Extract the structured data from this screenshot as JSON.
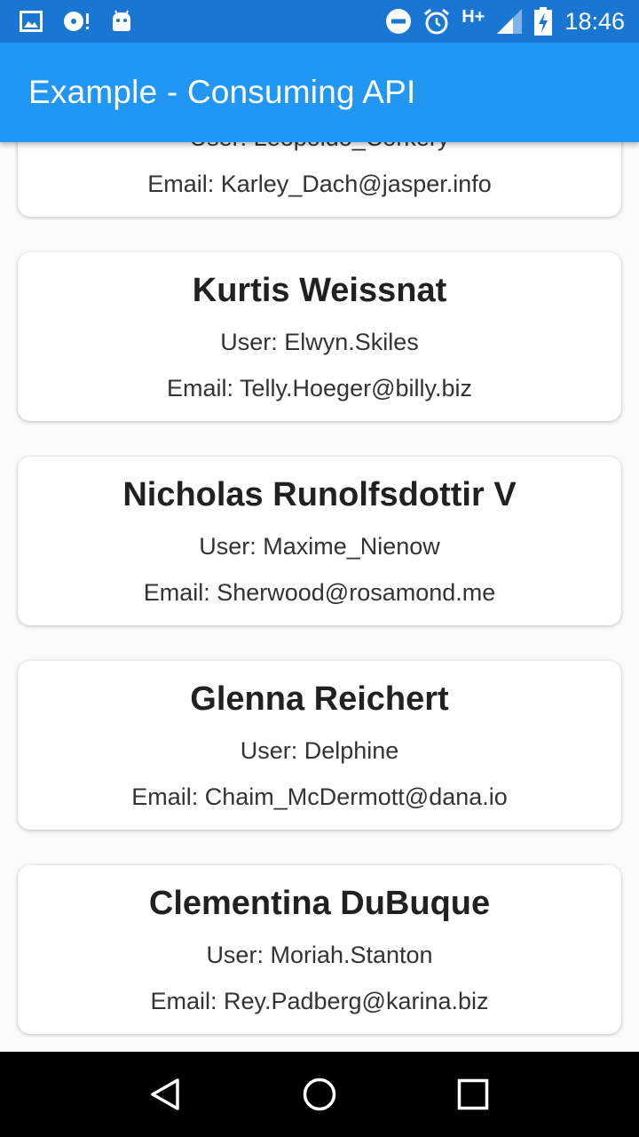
{
  "status_bar": {
    "icons_left": [
      "image-icon",
      "disc-icon",
      "android-icon"
    ],
    "network": "H+",
    "time": "18:46",
    "icons_right": [
      "do-not-disturb-icon",
      "alarm-icon",
      "signal-icon",
      "battery-charging-icon"
    ]
  },
  "app_bar": {
    "title": "Example - Consuming API"
  },
  "users": [
    {
      "name": "",
      "user": "User: Leopoldo_Corkery",
      "email": "Email: Karley_Dach@jasper.info"
    },
    {
      "name": "Kurtis Weissnat",
      "user": "User: Elwyn.Skiles",
      "email": "Email: Telly.Hoeger@billy.biz"
    },
    {
      "name": "Nicholas Runolfsdottir V",
      "user": "User: Maxime_Nienow",
      "email": "Email: Sherwood@rosamond.me"
    },
    {
      "name": "Glenna Reichert",
      "user": "User: Delphine",
      "email": "Email: Chaim_McDermott@dana.io"
    },
    {
      "name": "Clementina DuBuque",
      "user": "User: Moriah.Stanton",
      "email": "Email: Rey.Padberg@karina.biz"
    }
  ],
  "nav_bar": {
    "buttons": [
      "back-icon",
      "home-icon",
      "recents-icon"
    ]
  },
  "colors": {
    "status_bar": "#1976d2",
    "app_bar": "#2196f3",
    "background": "#fafafa",
    "nav_bar": "#000000"
  }
}
